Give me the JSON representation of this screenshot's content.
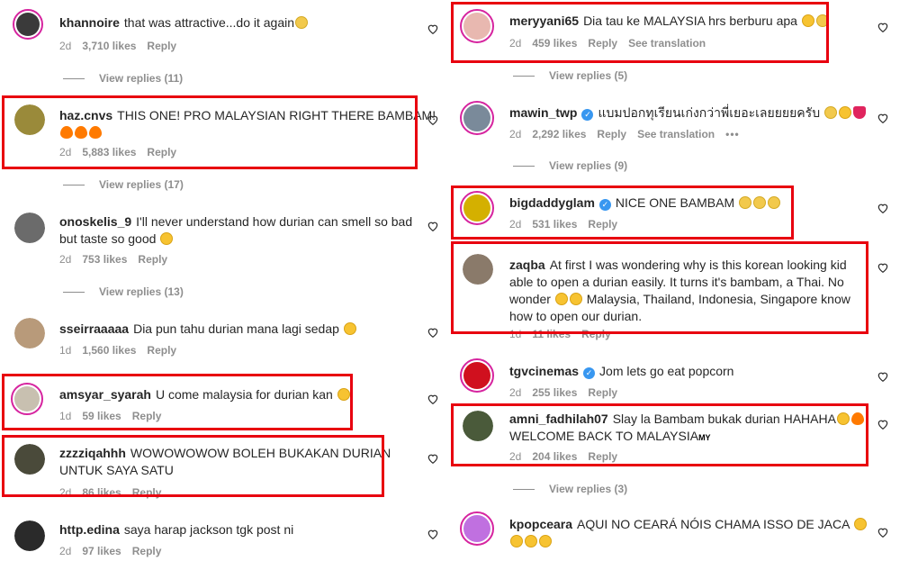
{
  "left": [
    {
      "username": "khannoire",
      "text": "that was attractive...do it again",
      "emoji": [
        "generic"
      ],
      "age": "2d",
      "likes": "3,710 likes",
      "reply": "Reply",
      "view_replies": "View replies (11)",
      "avatar_color": "#3a3a3a",
      "story": true
    },
    {
      "username": "haz.cnvs",
      "text": "THIS ONE! PRO MALAYSIAN RIGHT THERE BAMBAM!",
      "emoji_line2": [
        "fire",
        "fire",
        "fire"
      ],
      "age": "2d",
      "likes": "5,883 likes",
      "reply": "Reply",
      "view_replies": "View replies (17)",
      "avatar_color": "#9a8a3a",
      "story": false
    },
    {
      "username": "onoskelis_9",
      "text": "I'll never understand how durian can smell so bad",
      "text2": "but taste so good",
      "emoji_line2": [
        "laugh"
      ],
      "age": "2d",
      "likes": "753 likes",
      "reply": "Reply",
      "view_replies": "View replies (13)",
      "avatar_color": "#6b6b6b",
      "story": false
    },
    {
      "username": "sseirraaaaa",
      "text": "Dia pun tahu durian mana lagi sedap",
      "emoji": [
        "laugh"
      ],
      "age": "1d",
      "likes": "1,560 likes",
      "reply": "Reply",
      "avatar_color": "#b89a7a",
      "story": false
    },
    {
      "username": "amsyar_syarah",
      "text": "U come malaysia for durian kan",
      "emoji": [
        "laugh"
      ],
      "age": "1d",
      "likes": "59 likes",
      "reply": "Reply",
      "avatar_color": "#c8c0b0",
      "story": true
    },
    {
      "username": "zzzziqahhh",
      "text": "WOWOWOWOW BOLEH BUKAKAN DURIAN",
      "text2": "UNTUK SAYA SATU",
      "age": "2d",
      "likes": "86 likes",
      "reply": "Reply",
      "avatar_color": "#4a4a3a",
      "story": false
    },
    {
      "username": "http.edina",
      "text": "saya harap jackson tgk post ni",
      "age": "2d",
      "likes": "97 likes",
      "reply": "Reply",
      "avatar_color": "#2a2a2a",
      "story": false
    }
  ],
  "right": [
    {
      "username": "meryyani65",
      "text": "Dia tau ke MALAYSIA hrs berburu apa",
      "emoji": [
        "laugh",
        "generic"
      ],
      "age": "2d",
      "likes": "459 likes",
      "reply": "Reply",
      "translation": "See translation",
      "view_replies": "View replies (5)",
      "avatar_color": "#e8b8b0",
      "story": true
    },
    {
      "username": "mawin_twp",
      "verified": true,
      "text": "แบมปอกทุเรียนเก่งกว่าพี่เยอะเลยยยยครับ",
      "emoji": [
        "generic",
        "laugh",
        "heart"
      ],
      "age": "2d",
      "likes": "2,292 likes",
      "reply": "Reply",
      "translation": "See translation",
      "more": "•••",
      "view_replies": "View replies (9)",
      "avatar_color": "#7a8a9a",
      "story": true
    },
    {
      "username": "bigdaddyglam",
      "verified": true,
      "text": "NICE ONE BAMBAM",
      "emoji": [
        "generic",
        "generic",
        "generic"
      ],
      "age": "2d",
      "likes": "531 likes",
      "reply": "Reply",
      "avatar_color": "#d4b000",
      "story": true
    },
    {
      "username": "zaqba",
      "text": "At first I was wondering why is this korean looking kid",
      "text2": "able to open a durian easily. It turns it's bambam, a Thai. No",
      "text3a": "wonder",
      "text3b": "Malaysia, Thailand, Indonesia, Singapore know",
      "text4": "how to open our durian.",
      "age": "1d",
      "likes": "11 likes",
      "reply": "Reply",
      "avatar_color": "#8a7a6a",
      "story": false
    },
    {
      "username": "tgvcinemas",
      "verified": true,
      "text": "Jom lets go eat popcorn",
      "age": "2d",
      "likes": "255 likes",
      "reply": "Reply",
      "avatar_color": "#d0101e",
      "story": true
    },
    {
      "username": "amni_fadhilah07",
      "text": "Slay la Bambam bukak durian HAHAHA",
      "emoji": [
        "laugh",
        "fire"
      ],
      "text2": "WELCOME BACK TO MALAYSIA",
      "flag": "MY",
      "age": "2d",
      "likes": "204 likes",
      "reply": "Reply",
      "view_replies": "View replies (3)",
      "avatar_color": "#4a5a3a",
      "story": false
    },
    {
      "username": "kpopceara",
      "text": "AQUI NO CEARÁ NÓIS CHAMA ISSO DE JACA",
      "emoji": [
        "laugh"
      ],
      "emoji_line2": [
        "laugh",
        "laugh",
        "laugh"
      ],
      "avatar_color": "#c070e0",
      "story": true
    }
  ]
}
